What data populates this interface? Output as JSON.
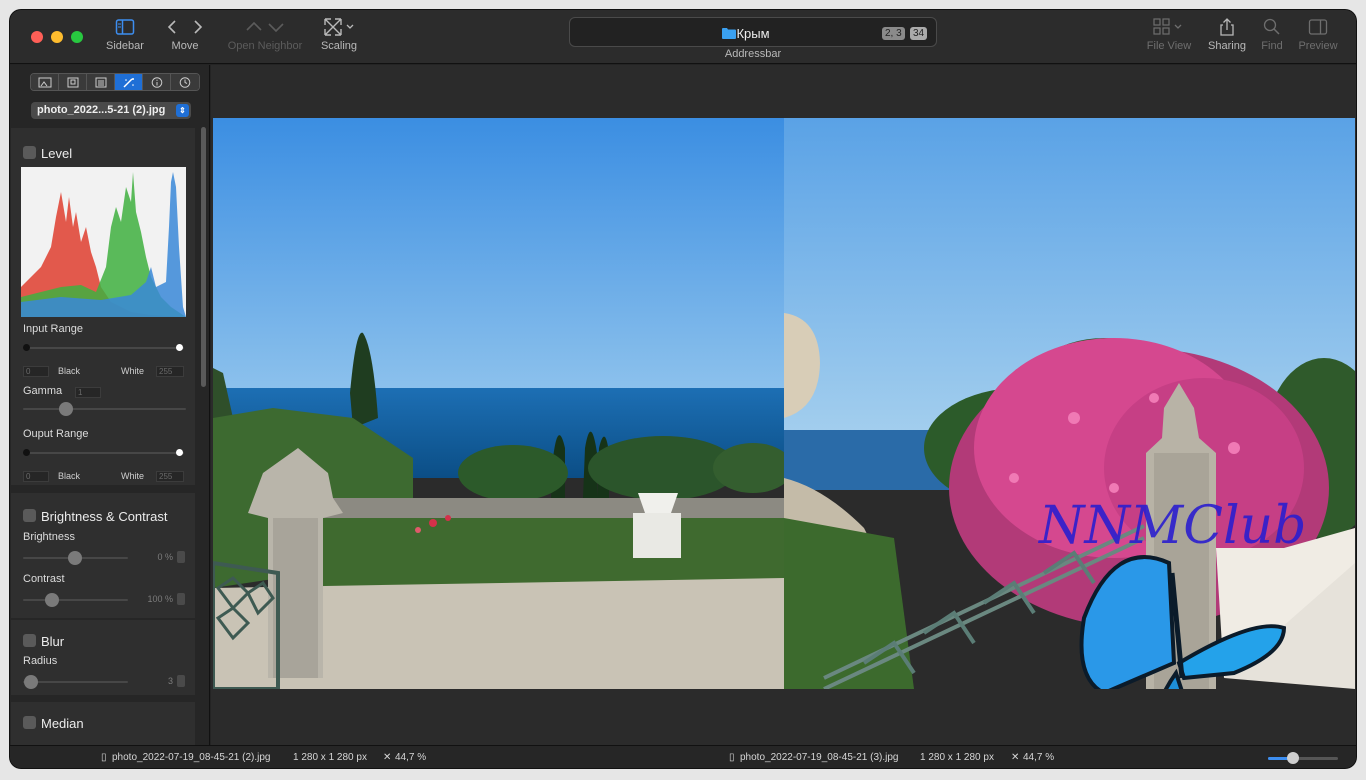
{
  "toolbar": {
    "sidebar": "Sidebar",
    "move": "Move",
    "open_neighbor": "Open Neighbor",
    "scaling": "Scaling",
    "file_view": "File View",
    "sharing": "Sharing",
    "find": "Find",
    "preview": "Preview"
  },
  "addressbar": {
    "label": "Addressbar",
    "title": "Крым",
    "badge_position": "2, 3",
    "badge_count": "34"
  },
  "sidebar": {
    "file_select": "photo_2022...5-21 (2).jpg",
    "level": {
      "title": "Level",
      "input_range": "Input Range",
      "black": "Black",
      "white": "White",
      "black_value": "0",
      "white_value": "255",
      "gamma": "Gamma",
      "gamma_value": "1",
      "output_range": "Ouput Range",
      "out_black_value": "0",
      "out_white_value": "255"
    },
    "brightness_contrast": {
      "title": "Brightness & Contrast",
      "brightness": "Brightness",
      "brightness_value": "0 %",
      "contrast": "Contrast",
      "contrast_value": "100 %"
    },
    "blur": {
      "title": "Blur",
      "radius": "Radius",
      "radius_value": "3"
    },
    "median": {
      "title": "Median"
    }
  },
  "images": {
    "watermark": "NNMClub"
  },
  "statusbar": {
    "left_file": "photo_2022-07-19_08-45-21 (2).jpg",
    "left_size": "1 280 x 1 280 px",
    "left_zoom": "44,7 %",
    "right_file": "photo_2022-07-19_08-45-21 (3).jpg",
    "right_size": "1 280 x 1 280 px",
    "right_zoom": "44,7 %"
  },
  "colors": {
    "accent": "#1f6fd6",
    "close": "#ff5f57",
    "minimize": "#febc2e",
    "zoom": "#28c840"
  }
}
